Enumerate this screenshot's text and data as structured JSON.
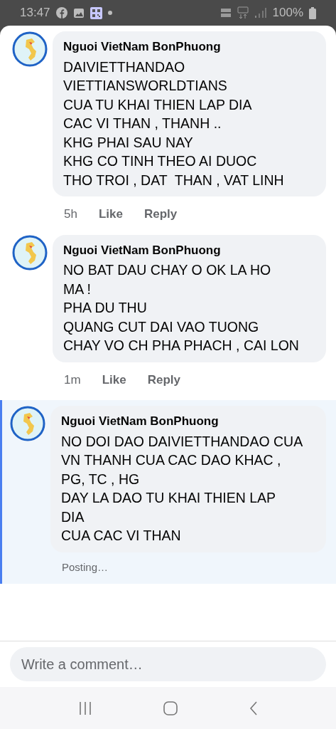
{
  "status_bar": {
    "time": "13:47",
    "battery": "100%"
  },
  "comments": [
    {
      "author": "Nguoi VietNam BonPhuong",
      "text": "DAIVIETTHANDAO\nVIETTIANSWORLDTIANS\nCUA TU KHAI THIEN LAP DIA\nCAC VI THAN , THANH ..\nKHG PHAI SAU NAY\nKHG CO TINH THEO AI DUOC\nTHO TROI , DAT  THAN , VAT LINH",
      "pending": false,
      "time": "5h",
      "actions": [
        "Like",
        "Reply"
      ]
    },
    {
      "author": "Nguoi VietNam BonPhuong",
      "text": "NO BAT DAU CHAY O OK LA HO\nMA !\nPHA DU THU\nQUANG CUT DAI VAO TUONG\nCHAY VO CH PHA PHACH , CAI LON",
      "pending": false,
      "time": "1m",
      "actions": [
        "Like",
        "Reply"
      ]
    },
    {
      "author": "Nguoi VietNam BonPhuong",
      "text": "NO DOI DAO DAIVIETTHANDAO CUA\nVN THANH CUA CAC DAO KHAC ,\nPG, TC , HG\nDAY LA DAO TU KHAI THIEN LAP\nDIA\nCUA CAC VI THAN",
      "pending": true,
      "status": "Posting…"
    }
  ],
  "composer": {
    "placeholder": "Write a comment…"
  }
}
